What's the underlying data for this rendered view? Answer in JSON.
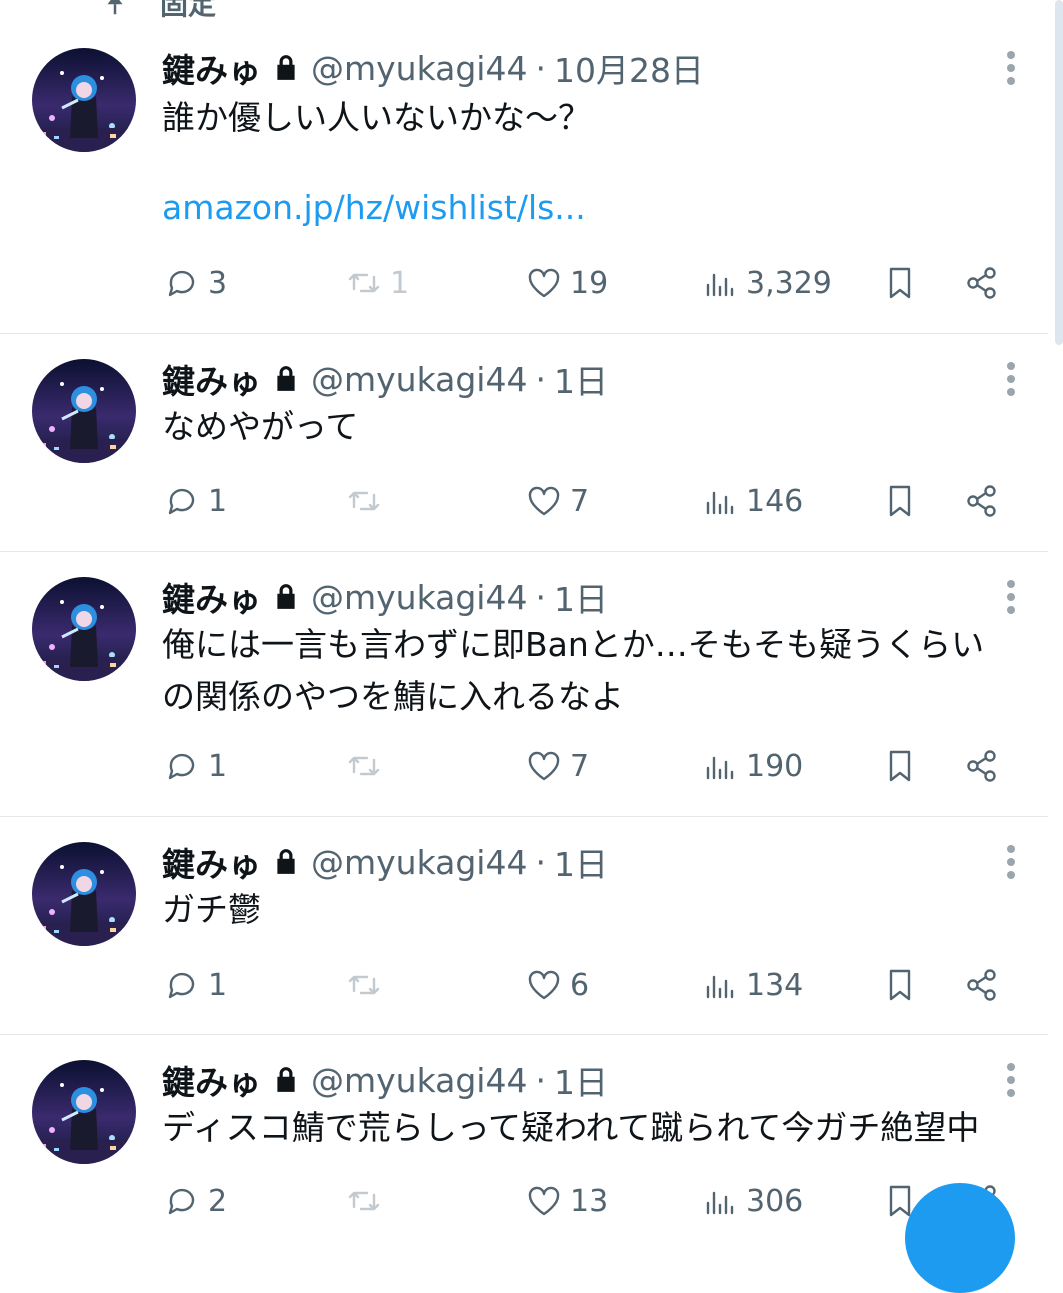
{
  "pinned_label": "固定",
  "colors": {
    "link": "#1d9bf0",
    "muted": "#536471",
    "retweet_disabled": "#c2cad0",
    "fab": "#1d9bf0"
  },
  "tweets": [
    {
      "name": "鍵みゅ",
      "handle": "@myukagi44",
      "separator": "·",
      "time": "10月28日",
      "text": "誰か優しい人いないかな〜？",
      "link": "amazon.jp/hz/wishlist/ls...",
      "replies": "3",
      "retweets": "1",
      "likes": "19",
      "views": "3,329"
    },
    {
      "name": "鍵みゅ",
      "handle": "@myukagi44",
      "separator": "·",
      "time": "1日",
      "text": "なめやがって",
      "replies": "1",
      "retweets": "",
      "likes": "7",
      "views": "146"
    },
    {
      "name": "鍵みゅ",
      "handle": "@myukagi44",
      "separator": "·",
      "time": "1日",
      "text": "俺には一言も言わずに即Banとか…そもそも疑うくらい\nの関係のやつを鯖に入れるなよ",
      "replies": "1",
      "retweets": "",
      "likes": "7",
      "views": "190"
    },
    {
      "name": "鍵みゅ",
      "handle": "@myukagi44",
      "separator": "·",
      "time": "1日",
      "text": "ガチ鬱",
      "replies": "1",
      "retweets": "",
      "likes": "6",
      "views": "134"
    },
    {
      "name": "鍵みゅ",
      "handle": "@myukagi44",
      "separator": "·",
      "time": "1日",
      "text": "ディスコ鯖で荒らしって疑われて蹴られて今ガチ絶望中",
      "replies": "2",
      "retweets": "",
      "likes": "13",
      "views": "306"
    }
  ]
}
